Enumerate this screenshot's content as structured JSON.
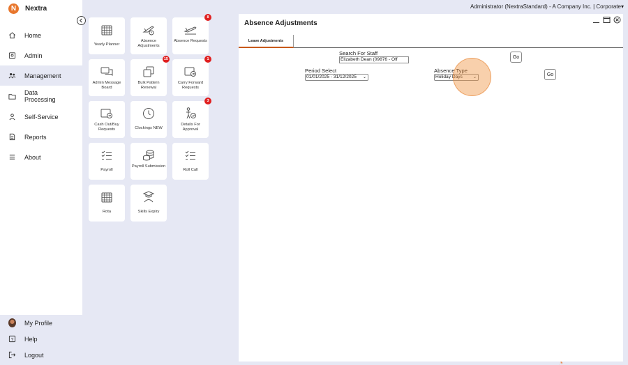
{
  "app": {
    "name": "Nextra"
  },
  "topbar": {
    "user_text": "Administrator (NextraStandard) - A Company Inc. | Corporate"
  },
  "sidebar": {
    "items": [
      {
        "label": "Home",
        "icon": "home-icon"
      },
      {
        "label": "Admin",
        "icon": "admin-icon"
      },
      {
        "label": "Management",
        "icon": "management-icon",
        "active": true
      },
      {
        "label": "Data Processing",
        "icon": "folder-icon"
      },
      {
        "label": "Self-Service",
        "icon": "person-icon"
      },
      {
        "label": "Reports",
        "icon": "report-icon"
      },
      {
        "label": "About",
        "icon": "menu-icon"
      }
    ],
    "bottom": [
      {
        "label": "My Profile",
        "icon": "avatar"
      },
      {
        "label": "Help",
        "icon": "help-icon"
      },
      {
        "label": "Logout",
        "icon": "logout-icon"
      }
    ]
  },
  "tiles": [
    {
      "label": "Yearly Planner",
      "icon": "calendar-icon"
    },
    {
      "label": "Absence Adjustments",
      "icon": "plane-alert-icon"
    },
    {
      "label": "Absence Requests",
      "icon": "plane-icon",
      "badge": "8"
    },
    {
      "label": "Admin Message Board",
      "icon": "messages-icon"
    },
    {
      "label": "Bulk Pattern Renewal",
      "icon": "copy-icon",
      "badge": "15"
    },
    {
      "label": "Carry Forward Requests",
      "icon": "forward-icon",
      "badge": "1"
    },
    {
      "label": "Cash Out/Buy Requests",
      "icon": "cashout-icon"
    },
    {
      "label": "Clockings NEW",
      "icon": "clock-icon"
    },
    {
      "label": "Details For Approval",
      "icon": "approval-icon",
      "badge": "3"
    },
    {
      "label": "Payroll",
      "icon": "checklist-icon"
    },
    {
      "label": "Payroll Submission",
      "icon": "coins-icon"
    },
    {
      "label": "Roll Call",
      "icon": "checklist-icon"
    },
    {
      "label": "Rota",
      "icon": "calendar-icon"
    },
    {
      "label": "Skills Expiry",
      "icon": "graduate-icon"
    }
  ],
  "panel": {
    "title": "Absence Adjustments",
    "tab": "Leave Adjustments",
    "search_label": "Search For Staff",
    "search_value": "Elizabeth  Dean (09876 - Off",
    "go_label": "Go",
    "period_label": "Period Select",
    "period_value": "01/01/2025 - 31/12/2025",
    "absence_label": "Absence Type",
    "absence_value": "Holiday Days"
  },
  "colors": {
    "accent": "#e8762c",
    "badge": "#e02020",
    "background": "#e6e8f4"
  }
}
